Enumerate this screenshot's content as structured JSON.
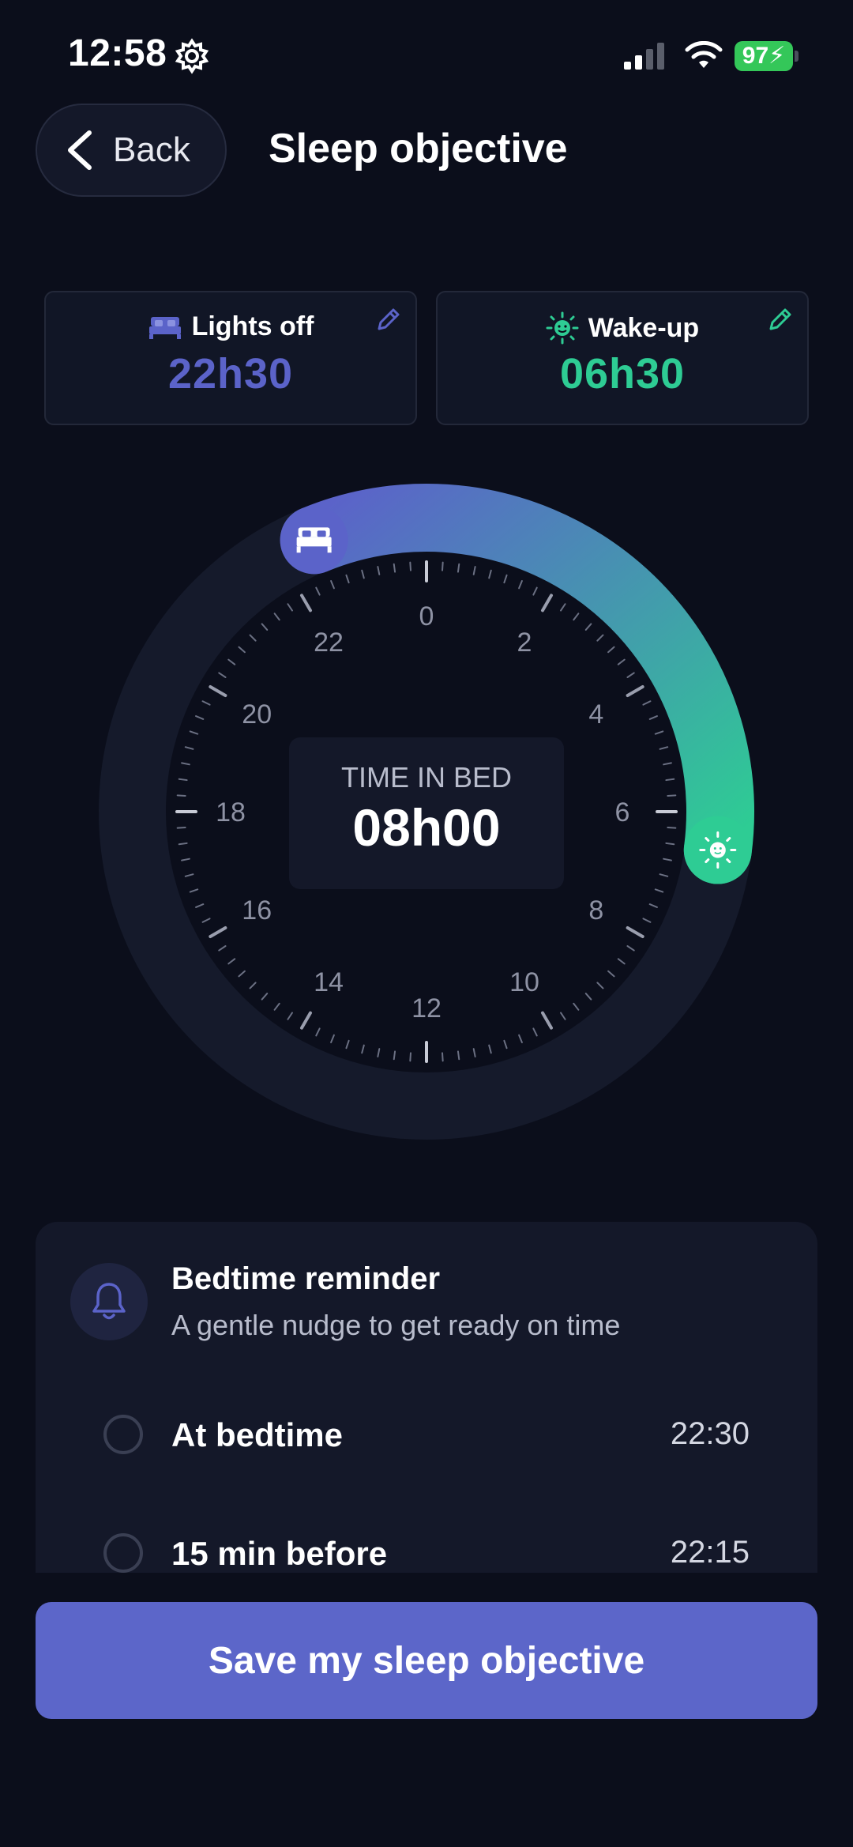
{
  "status_bar": {
    "time": "12:58",
    "battery": "97"
  },
  "header": {
    "back_label": "Back",
    "title": "Sleep objective"
  },
  "cards": {
    "lights_off": {
      "label": "Lights off",
      "value": "22h30",
      "color": "#5b63c9"
    },
    "wake_up": {
      "label": "Wake-up",
      "value": "06h30",
      "color": "#2ecc94"
    }
  },
  "clock": {
    "hour_labels": [
      "0",
      "2",
      "4",
      "6",
      "8",
      "10",
      "12",
      "14",
      "16",
      "18",
      "20",
      "22"
    ],
    "center_title": "TIME IN BED",
    "center_value": "08h00",
    "arc_start_color": "#5b63c9",
    "arc_end_color": "#2ecc94",
    "bedtime_hour": 22.5,
    "wake_hour": 6.5
  },
  "reminder": {
    "title": "Bedtime reminder",
    "subtitle": "A gentle nudge to get ready on time",
    "options": [
      {
        "label": "At bedtime",
        "time": "22:30"
      },
      {
        "label": "15 min before",
        "time": "22:15"
      }
    ]
  },
  "save_button": "Save my sleep objective"
}
